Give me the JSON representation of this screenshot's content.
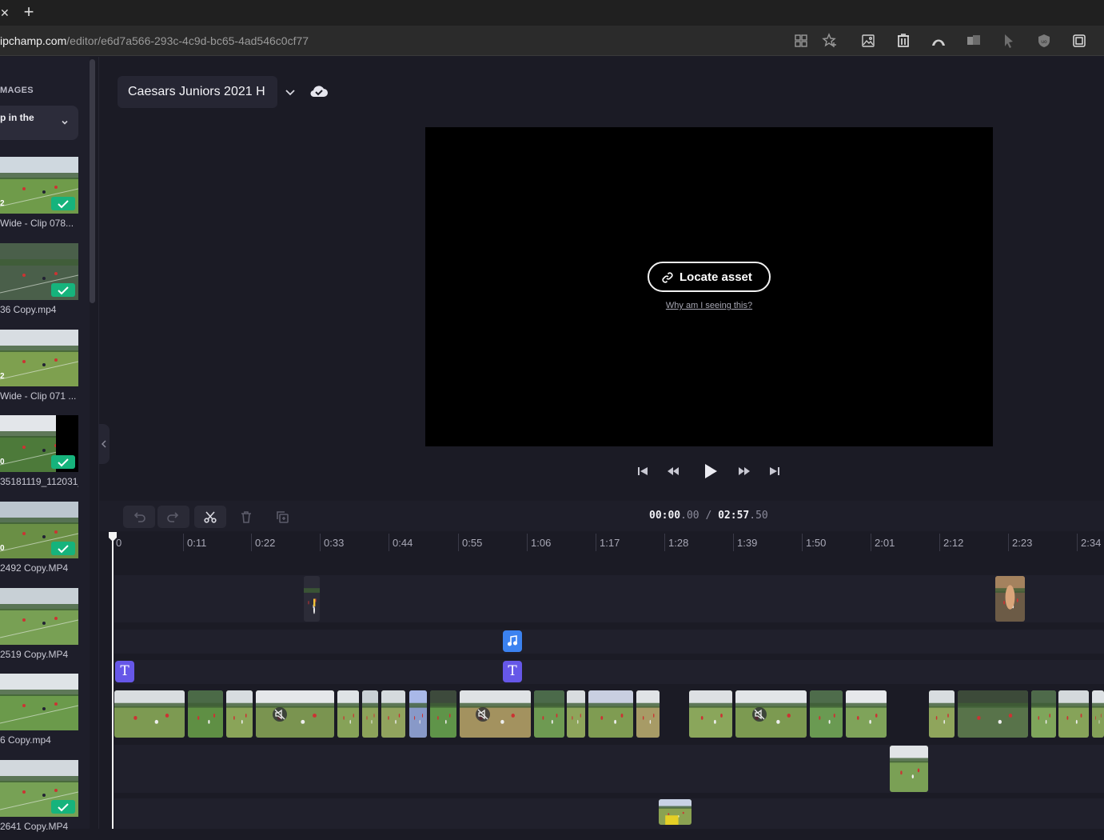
{
  "browser": {
    "close_glyph": "✕",
    "new_tab_glyph": "+",
    "url_host": "ipchamp.com",
    "url_path": "/editor/e6d7a566-293c-4c9d-bc65-4ad546c0cf77"
  },
  "media_panel": {
    "section_label": "MAGES",
    "filter_text": "p in the",
    "items": [
      {
        "name": "Wide - Clip 078...",
        "num": "2",
        "checked": true
      },
      {
        "name": "36 Copy.mp4",
        "num": "",
        "checked": true
      },
      {
        "name": "Wide - Clip 071 ...",
        "num": "2",
        "checked": false
      },
      {
        "name": "35181119_112031_...",
        "num": "0",
        "checked": true
      },
      {
        "name": "2492 Copy.MP4",
        "num": "0",
        "checked": true
      },
      {
        "name": "2519 Copy.MP4",
        "num": "",
        "checked": false
      },
      {
        "name": "6 Copy.mp4",
        "num": "",
        "checked": false
      },
      {
        "name": "2641 Copy.MP4",
        "num": "",
        "checked": true
      }
    ]
  },
  "editor": {
    "project_name": "Caesars Juniors 2021 H",
    "locate_button": "Locate asset",
    "why_link": "Why am I seeing this?"
  },
  "timeline": {
    "current_time_main": "00:00",
    "current_time_frac": ".00",
    "separator": " / ",
    "total_time_main": "02:57",
    "total_time_frac": ".50",
    "ruler_labels": [
      "0",
      "0:11",
      "0:22",
      "0:33",
      "0:44",
      "0:55",
      "1:06",
      "1:17",
      "1:28",
      "1:39",
      "1:50",
      "2:01",
      "2:12",
      "2:23",
      "2:34"
    ],
    "text_badge": "T"
  },
  "colors": {
    "accent_check": "#16b37c",
    "text_badge": "#6657e8",
    "audio_badge": "#3b82f0",
    "background": "#1b1b25"
  }
}
